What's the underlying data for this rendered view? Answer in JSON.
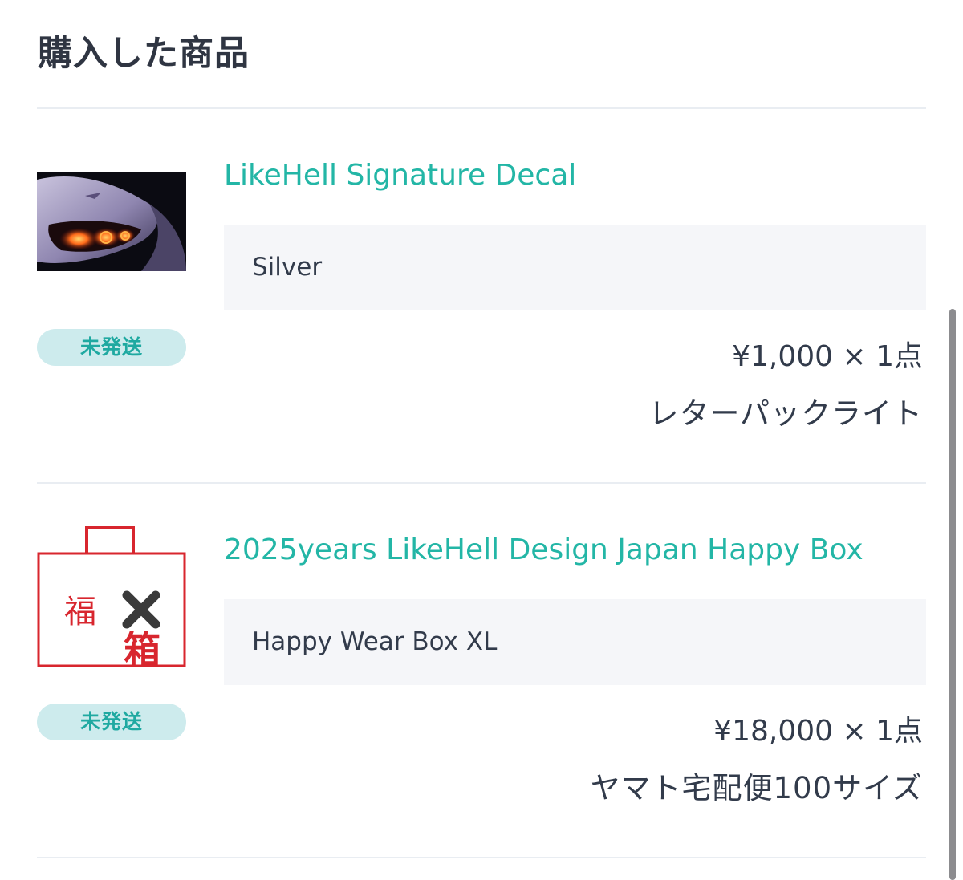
{
  "header": {
    "title": "購入した商品"
  },
  "items": [
    {
      "name": "LikeHell Signature Decal",
      "variant": "Silver",
      "status": "未発送",
      "price": "¥1,000 × 1点",
      "shipping": "レターパックライト",
      "thumbnail_icon": "car-taillight-photo-icon"
    },
    {
      "name": "2025years LikeHell Design Japan Happy Box",
      "variant": "Happy Wear Box XL",
      "status": "未発送",
      "price": "¥18,000 × 1点",
      "shipping": "ヤマト宅配便100サイズ",
      "thumbnail_icon": "fukubukuro-bag-icon",
      "thumbnail_text": {
        "fuku": "福",
        "bako": "箱"
      }
    }
  ],
  "colors": {
    "accent": "#23b6a6",
    "badge_bg": "#cdebed",
    "badge_text": "#1fa9a1",
    "variant_bg": "#f5f6f9",
    "text": "#323b4b",
    "bag_red": "#d8262e"
  }
}
